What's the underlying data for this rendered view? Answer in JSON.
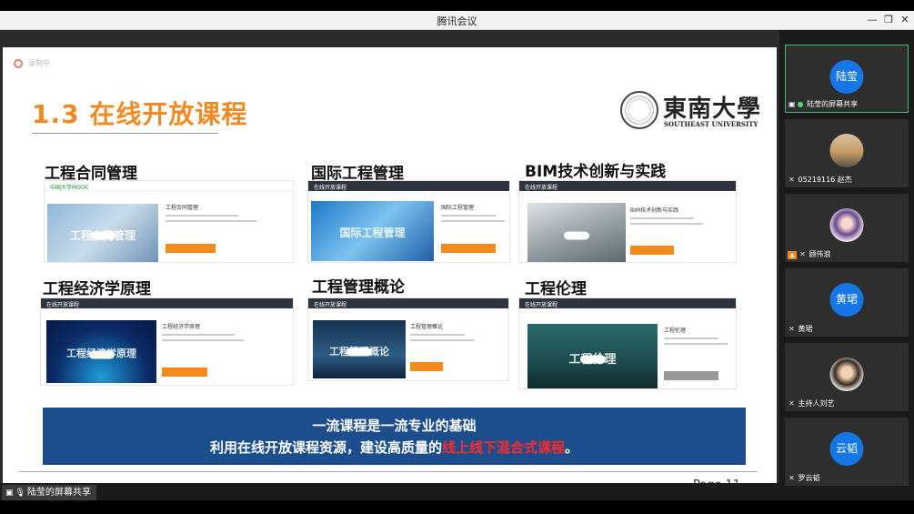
{
  "window": {
    "title": "腾讯会议",
    "minimize_icon": "—",
    "restore_icon": "❐",
    "close_icon": "✕"
  },
  "slide": {
    "rec_text": "录制中",
    "title": "1.3 在线开放课程",
    "logo_cn": "東南大學",
    "logo_en": "SOUTHEAST UNIVERSITY",
    "courses": [
      {
        "name": "工程合同管理",
        "thumb_text": "工程合同管理",
        "info_title": "工程合同管理"
      },
      {
        "name": "国际工程管理",
        "thumb_text": "国际工程管理",
        "info_title": "国际工程管理"
      },
      {
        "name": "BIM技术创新与实践",
        "thumb_text": "",
        "info_title": "BIM技术创新与实践"
      },
      {
        "name": "工程经济学原理",
        "thumb_text": "工程经济学原理",
        "info_title": "工程经济学原理"
      },
      {
        "name": "工程管理概论",
        "thumb_text": "工程管理概论",
        "info_title": "工程管理概论"
      },
      {
        "name": "工程伦理",
        "thumb_text": "工程伦理",
        "info_title": "工程伦理"
      }
    ],
    "card_logos": [
      "中国大学MOOC",
      "在线开放课程",
      "在线开放课程",
      "在线开放课程",
      "在线开放课程",
      "在线开放课程"
    ],
    "banner_line1": "一流课程是一流专业的基础",
    "banner_line2_prefix": "利用在线开放课程资源，建设高质量的",
    "banner_line2_highlight": "线上线下混合式课程",
    "banner_line2_suffix": "。",
    "page_number": "Page 11"
  },
  "status": {
    "share_label": "陆莹的屏幕共享"
  },
  "participants": [
    {
      "avatar_text": "陆莹",
      "name": "陆莹的屏幕共享"
    },
    {
      "avatar_text": "",
      "name": "05219116 赵杰"
    },
    {
      "avatar_text": "",
      "name": "顾伟浪"
    },
    {
      "avatar_text": "黄珺",
      "name": "黄珺"
    },
    {
      "avatar_text": "",
      "name": "主持人刘艺"
    },
    {
      "avatar_text": "云韬",
      "name": "罗云韬"
    }
  ],
  "colors": {
    "accent_orange": "#f08a24",
    "banner_blue": "#1c4d8c",
    "highlight_red": "#ff2b2b",
    "avatar_blue": "#1577e6",
    "active_green": "#3fbf70"
  }
}
